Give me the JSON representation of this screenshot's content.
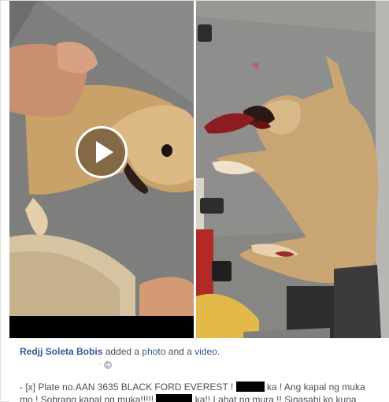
{
  "post": {
    "author": "Redjj Soleta Bobis",
    "action_prefix": " added a ",
    "action_photo": "photo",
    "action_and": " and a ",
    "action_video": "video",
    "action_suffix": ".",
    "time_separator": "·",
    "privacy_icon": "globe-icon",
    "text_line1_a": "- [x] Plate no.AAN 3635 BLACK FORD EVEREST ! ",
    "text_line1_b": " ka ! Ang kapal ng muka",
    "text_line2_a": "mo ! Sobrang kapal ng muka!!!!! ",
    "text_line2_b": " ka!! Lahat ng mura !! Sinasabi ko kuna"
  },
  "media": {
    "video": {
      "play_icon": "play-icon"
    },
    "photo": {}
  },
  "colors": {
    "link": "#365899",
    "text": "#4b4f56",
    "meta": "#90949c"
  }
}
